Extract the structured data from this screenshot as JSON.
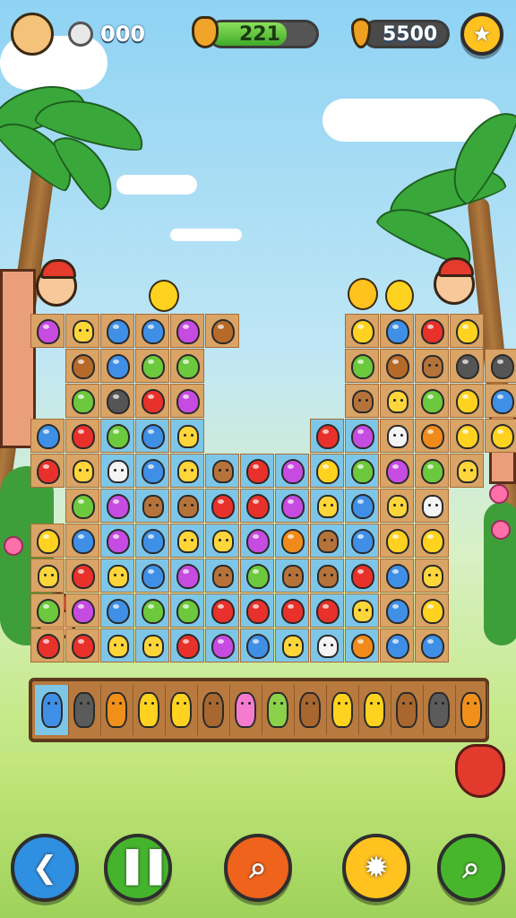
{
  "hud": {
    "coins_count": "000",
    "progress_value": "221",
    "progress_fraction": 0.72,
    "carrot_count": "5500",
    "avatar_icon": "mascot-face-icon",
    "coin_icon": "silver-coin-icon",
    "acorn_icon": "acorn-icon",
    "carrot_icon": "carrot-icon",
    "settings_icon": "star-settings-icon"
  },
  "colors": {
    "gem_blue": "#3f8fe6",
    "gem_purple": "#c64be0",
    "gem_red": "#e8312a",
    "gem_green": "#6cc83c",
    "gem_yellow": "#ffd21f",
    "gem_orange": "#f08a1a",
    "gem_brown": "#b66a2a",
    "gem_gray": "#555555",
    "critter_yellow": "#ffd63a",
    "critter_brown": "#b5733a",
    "critter_white": "#f4f4f4"
  },
  "board": {
    "rows": [
      [
        "purple",
        "critter_yellow",
        "blue",
        "blue",
        "purple",
        "brown",
        "",
        "",
        "",
        "yellow",
        "blue",
        "red",
        "yellow",
        ""
      ],
      [
        "",
        "brown",
        "blue",
        "green",
        "green",
        "",
        "",
        "",
        "",
        "green",
        "brown",
        "critter_brown",
        "gray",
        "gray"
      ],
      [
        "",
        "green",
        "gray",
        "red",
        "purple",
        "",
        "",
        "",
        "",
        "critter_brown",
        "critter_yellow",
        "green",
        "yellow",
        "blue"
      ],
      [
        "blue",
        "red",
        "green",
        "blue",
        "critter_yellow",
        "",
        "",
        "",
        "red",
        "purple",
        "critter_white",
        "orange",
        "yellow",
        "yellow"
      ],
      [
        "red",
        "critter_yellow",
        "critter_white",
        "blue",
        "critter_yellow",
        "critter_brown",
        "red",
        "purple",
        "yellow",
        "green",
        "purple",
        "green",
        "critter_yellow",
        ""
      ],
      [
        "",
        "green",
        "purple",
        "critter_brown",
        "critter_brown",
        "red",
        "red",
        "purple",
        "critter_yellow",
        "blue",
        "critter_yellow",
        "critter_white",
        "",
        ""
      ],
      [
        "yellow",
        "blue",
        "purple",
        "blue",
        "critter_yellow",
        "critter_yellow",
        "purple",
        "orange",
        "critter_brown",
        "blue",
        "yellow",
        "yellow",
        "",
        ""
      ],
      [
        "critter_yellow",
        "red",
        "critter_yellow",
        "blue",
        "purple",
        "critter_brown",
        "green",
        "critter_brown",
        "critter_brown",
        "red",
        "blue",
        "critter_yellow",
        "",
        ""
      ],
      [
        "green",
        "purple",
        "blue",
        "green",
        "green",
        "red",
        "red",
        "red",
        "red",
        "critter_yellow",
        "blue",
        "yellow",
        "",
        ""
      ],
      [
        "red",
        "red",
        "critter_yellow",
        "critter_yellow",
        "red",
        "purple",
        "blue",
        "critter_yellow",
        "critter_white",
        "orange",
        "blue",
        "blue",
        "",
        ""
      ]
    ]
  },
  "tray": {
    "animals": [
      "blue",
      "gray",
      "orange",
      "yellow",
      "yellow",
      "brown",
      "pink",
      "green",
      "brown",
      "yellow",
      "yellow",
      "brown",
      "gray",
      "orange"
    ]
  },
  "toolbar": {
    "buttons": [
      {
        "icon": "back-arrow-icon",
        "color": "#2f8fe0"
      },
      {
        "icon": "pause-icon",
        "color": "#45b42d"
      },
      {
        "icon": "magnifier-icon",
        "color": "#f0631c"
      },
      {
        "icon": "burst-icon",
        "color": "#ffc21f"
      },
      {
        "icon": "zoom-icon",
        "color": "#47b62b"
      }
    ]
  }
}
